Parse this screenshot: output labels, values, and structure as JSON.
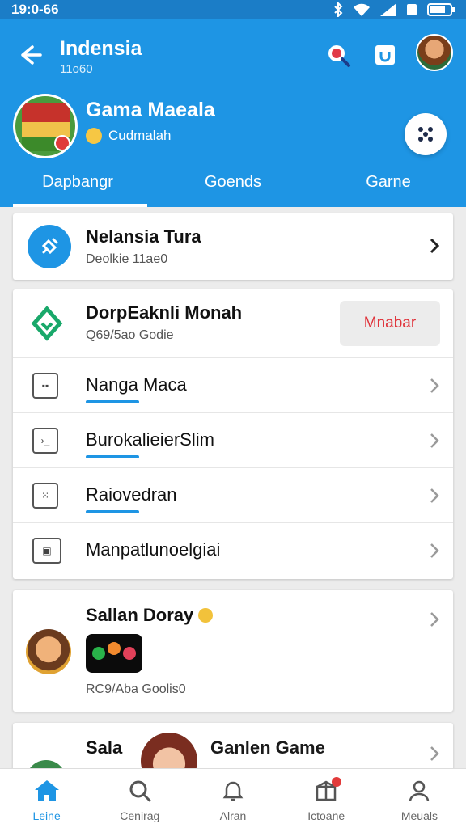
{
  "status": {
    "time": "19:0-66"
  },
  "header": {
    "title": "Indensia",
    "subtitle": "11o60",
    "profile_name": "Gama Maeala",
    "profile_sub": "Cudmalah"
  },
  "tabs": [
    {
      "label": "Dapbangr",
      "active": true
    },
    {
      "label": "Goends"
    },
    {
      "label": "Garne"
    }
  ],
  "card1": {
    "title": "Nelansia Tura",
    "subtitle": "Deolkie 11ae0"
  },
  "card2": {
    "title": "DorpEaknli Monah",
    "subtitle": "Q69/5ao Godie",
    "button": "Mnabar",
    "rows": [
      {
        "label": "Nanga Maca",
        "icon": "grid-icon"
      },
      {
        "label": "BurokalieierSlim",
        "icon": "terminal-icon"
      },
      {
        "label": "Raiovedran",
        "icon": "dice-icon"
      },
      {
        "label": "Manpatlunoelgiai",
        "icon": "media-icon"
      }
    ]
  },
  "card3": {
    "title": "Sallan Doray",
    "subtitle": "RC9/Aba Goolis0"
  },
  "card4": {
    "title": "Sala",
    "title2": "Ganlen Game"
  },
  "nav": [
    {
      "label": "Leine",
      "icon": "home-icon",
      "active": true
    },
    {
      "label": "Cenirag",
      "icon": "search-icon"
    },
    {
      "label": "Alran",
      "icon": "bell-icon"
    },
    {
      "label": "Ictoane",
      "icon": "gift-icon"
    },
    {
      "label": "Meuals",
      "icon": "person-icon"
    }
  ],
  "colors": {
    "primary": "#1e95e4",
    "status": "#1b7dc7",
    "accent_red": "#e0323a"
  }
}
